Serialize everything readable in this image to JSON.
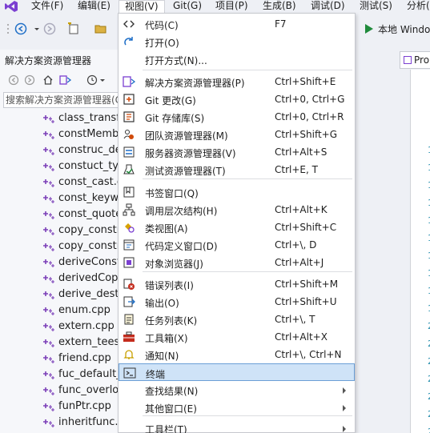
{
  "menubar": {
    "items": [
      {
        "label": "文件(F)"
      },
      {
        "label": "编辑(E)"
      },
      {
        "label": "视图(V)"
      },
      {
        "label": "Git(G)"
      },
      {
        "label": "项目(P)"
      },
      {
        "label": "生成(B)"
      },
      {
        "label": "调试(D)"
      },
      {
        "label": "测试(S)"
      },
      {
        "label": "分析("
      }
    ],
    "active_index": 2
  },
  "toolbar": {
    "run_label": "本地 Windo"
  },
  "solution_explorer": {
    "title": "解决方案资源管理器",
    "search_placeholder": "搜索解决方案资源管理器(C",
    "files": [
      "class_transfe",
      "constMembe",
      "construc_des",
      "constuct_type",
      "const_cast.cp",
      "const_keywo",
      "const_quote.",
      "copy_constru",
      "copy_constru",
      "deriveConstr",
      "derivedCopy",
      "derive_destru",
      "enum.cpp",
      "extern.cpp",
      "extern_teest.",
      "friend.cpp",
      "fuc_default_p",
      "func_overloa",
      "funPtr.cpp",
      "inheritfunc.cp"
    ]
  },
  "document": {
    "tab_label": "Pro",
    "line_numbers": [
      "1",
      "1",
      "1",
      "1",
      "1",
      "1",
      "1",
      "1",
      "1",
      "1",
      "2",
      "2",
      "2",
      "2",
      "2",
      "2",
      "2",
      "2",
      "2",
      "2",
      "2"
    ]
  },
  "view_menu": {
    "items": [
      {
        "icon": "code-icon",
        "label": "代码(C)",
        "shortcut": "F7"
      },
      {
        "icon": "open-icon",
        "label": "打开(O)",
        "shortcut": ""
      },
      {
        "icon": "",
        "label": "打开方式(N)...",
        "shortcut": ""
      },
      {
        "icon": "solution-explorer-icon",
        "label": "解决方案资源管理器(P)",
        "shortcut": "Ctrl+Shift+E"
      },
      {
        "icon": "git-changes-icon",
        "label": "Git 更改(G)",
        "shortcut": "Ctrl+0, Ctrl+G"
      },
      {
        "icon": "git-repo-icon",
        "label": "Git 存储库(S)",
        "shortcut": "Ctrl+0, Ctrl+R"
      },
      {
        "icon": "team-explorer-icon",
        "label": "团队资源管理器(M)",
        "shortcut": "Ctrl+Shift+G"
      },
      {
        "icon": "server-explorer-icon",
        "label": "服务器资源管理器(V)",
        "shortcut": "Ctrl+Alt+S"
      },
      {
        "icon": "test-explorer-icon",
        "label": "测试资源管理器(T)",
        "shortcut": "Ctrl+E, T"
      },
      {
        "icon": "bookmark-icon",
        "label": "书签窗口(Q)",
        "shortcut": ""
      },
      {
        "icon": "call-hierarchy-icon",
        "label": "调用层次结构(H)",
        "shortcut": "Ctrl+Alt+K"
      },
      {
        "icon": "class-view-icon",
        "label": "类视图(A)",
        "shortcut": "Ctrl+Shift+C"
      },
      {
        "icon": "code-definition-icon",
        "label": "代码定义窗口(D)",
        "shortcut": "Ctrl+\\, D"
      },
      {
        "icon": "object-browser-icon",
        "label": "对象浏览器(J)",
        "shortcut": "Ctrl+Alt+J"
      },
      {
        "icon": "error-list-icon",
        "label": "错误列表(I)",
        "shortcut": "Ctrl+Shift+M"
      },
      {
        "icon": "output-icon",
        "label": "输出(O)",
        "shortcut": "Ctrl+Shift+U"
      },
      {
        "icon": "task-list-icon",
        "label": "任务列表(K)",
        "shortcut": "Ctrl+\\, T"
      },
      {
        "icon": "toolbox-icon",
        "label": "工具箱(X)",
        "shortcut": "Ctrl+Alt+X"
      },
      {
        "icon": "notification-bell-icon",
        "label": "通知(N)",
        "shortcut": "Ctrl+\\, Ctrl+N"
      },
      {
        "icon": "terminal-icon",
        "label": "终端",
        "shortcut": ""
      },
      {
        "icon": "",
        "label": "查找结果(N)",
        "shortcut": ""
      },
      {
        "icon": "",
        "label": "其他窗口(E)",
        "shortcut": ""
      },
      {
        "icon": "",
        "label": "工具栏(T)",
        "shortcut": ""
      }
    ]
  }
}
